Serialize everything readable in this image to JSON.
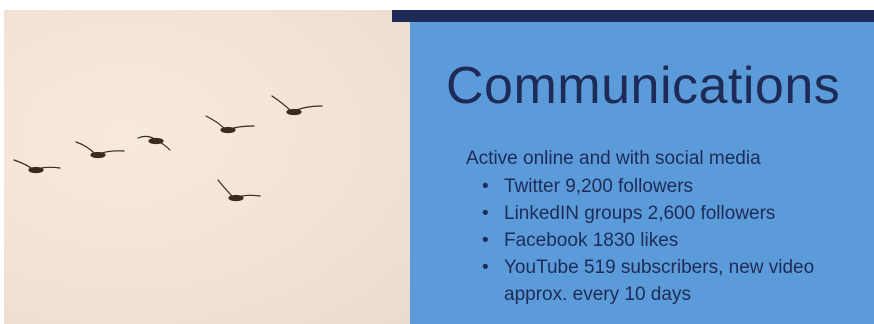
{
  "slide": {
    "title": "Communications",
    "subtitle": "Active online and with social media",
    "bullets": [
      "Twitter 9,200 followers",
      "LinkedIN groups 2,600 followers",
      "Facebook 1830 likes",
      "YouTube 519 subscribers, new video approx. every 10 days"
    ]
  },
  "colors": {
    "panel_blue": "#5b9bd9",
    "navy": "#1f2b57",
    "photo_sky": "#f3e4d6"
  },
  "image": {
    "subject": "birds-flying-icon"
  }
}
